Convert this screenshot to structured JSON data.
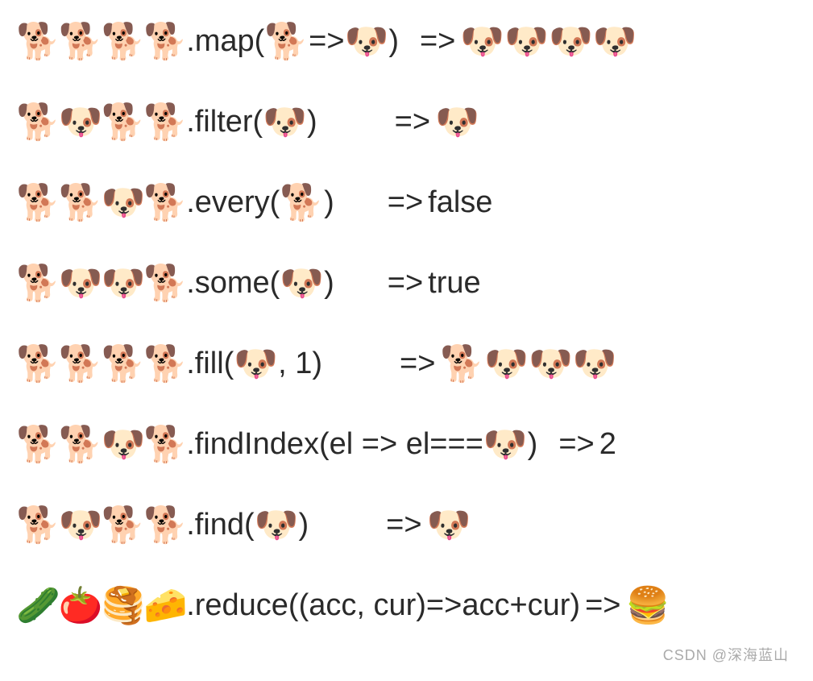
{
  "icons": {
    "dog": "🐕",
    "dogface": "🐶",
    "cucumber": "🥒",
    "tomato": "🍅",
    "pancakes": "🥞",
    "cheese": "🧀",
    "burger": "🍔"
  },
  "lines": [
    {
      "array": [
        "dog",
        "dog",
        "dog",
        "dog"
      ],
      "method": ".map(",
      "args_pre_icon": "",
      "args_icons": [
        "dog"
      ],
      "args_mid": "=>",
      "args_icons2": [
        "dogface"
      ],
      "method_close": ")",
      "spacer": "sm",
      "arrow": "=>",
      "result_icons": [
        "dogface",
        "dogface",
        "dogface",
        "dogface"
      ],
      "result_text": ""
    },
    {
      "array": [
        "dog",
        "dogface",
        "dog",
        "dog"
      ],
      "method": ".filter(",
      "args_pre_icon": "",
      "args_icons": [
        "dogface"
      ],
      "args_mid": "",
      "args_icons2": [],
      "method_close": ")",
      "spacer": "md",
      "arrow": "=>",
      "result_icons": [
        "dogface"
      ],
      "result_text": ""
    },
    {
      "array": [
        "dog",
        "dog",
        "dogface",
        "dog"
      ],
      "method": ".every(",
      "args_pre_icon": "",
      "args_icons": [
        "dog"
      ],
      "args_mid": "",
      "args_icons2": [],
      "method_close": ")",
      "spacer": "lg",
      "arrow": "=>",
      "result_icons": [],
      "result_text": "false"
    },
    {
      "array": [
        "dog",
        "dogface",
        "dogface",
        "dog"
      ],
      "method": ".some(",
      "args_pre_icon": "",
      "args_icons": [
        "dogface"
      ],
      "args_mid": "",
      "args_icons2": [],
      "method_close": ")",
      "spacer": "lg",
      "arrow": "=>",
      "result_icons": [],
      "result_text": "true"
    },
    {
      "array": [
        "dog",
        "dog",
        "dog",
        "dog"
      ],
      "method": ".fill(",
      "args_pre_icon": "",
      "args_icons": [
        "dogface"
      ],
      "args_mid": ", 1",
      "args_icons2": [],
      "method_close": ")",
      "spacer": "md",
      "arrow": "=>",
      "result_icons": [
        "dog",
        "dogface",
        "dogface",
        "dogface"
      ],
      "result_text": ""
    },
    {
      "array": [
        "dog",
        "dog",
        "dogface",
        "dog"
      ],
      "method": ".findIndex(el => el===",
      "args_pre_icon": "",
      "args_icons": [
        "dogface"
      ],
      "args_mid": "",
      "args_icons2": [],
      "method_close": ")",
      "spacer": "sm",
      "arrow": "=>",
      "result_icons": [],
      "result_text": "2"
    },
    {
      "array": [
        "dog",
        "dogface",
        "dog",
        "dog"
      ],
      "method": ".find(",
      "args_pre_icon": "",
      "args_icons": [
        "dogface"
      ],
      "args_mid": "",
      "args_icons2": [],
      "method_close": ")",
      "spacer": "md",
      "arrow": "=>",
      "result_icons": [
        "dogface"
      ],
      "result_text": ""
    },
    {
      "array": [
        "cucumber",
        "tomato",
        "pancakes",
        "cheese"
      ],
      "method": ".reduce((acc, cur)=>acc+cur)",
      "args_pre_icon": "",
      "args_icons": [],
      "args_mid": "",
      "args_icons2": [],
      "method_close": "",
      "spacer": "none",
      "arrow": "=>",
      "result_icons": [
        "burger"
      ],
      "result_text": ""
    }
  ],
  "watermark": "CSDN @深海蓝山"
}
